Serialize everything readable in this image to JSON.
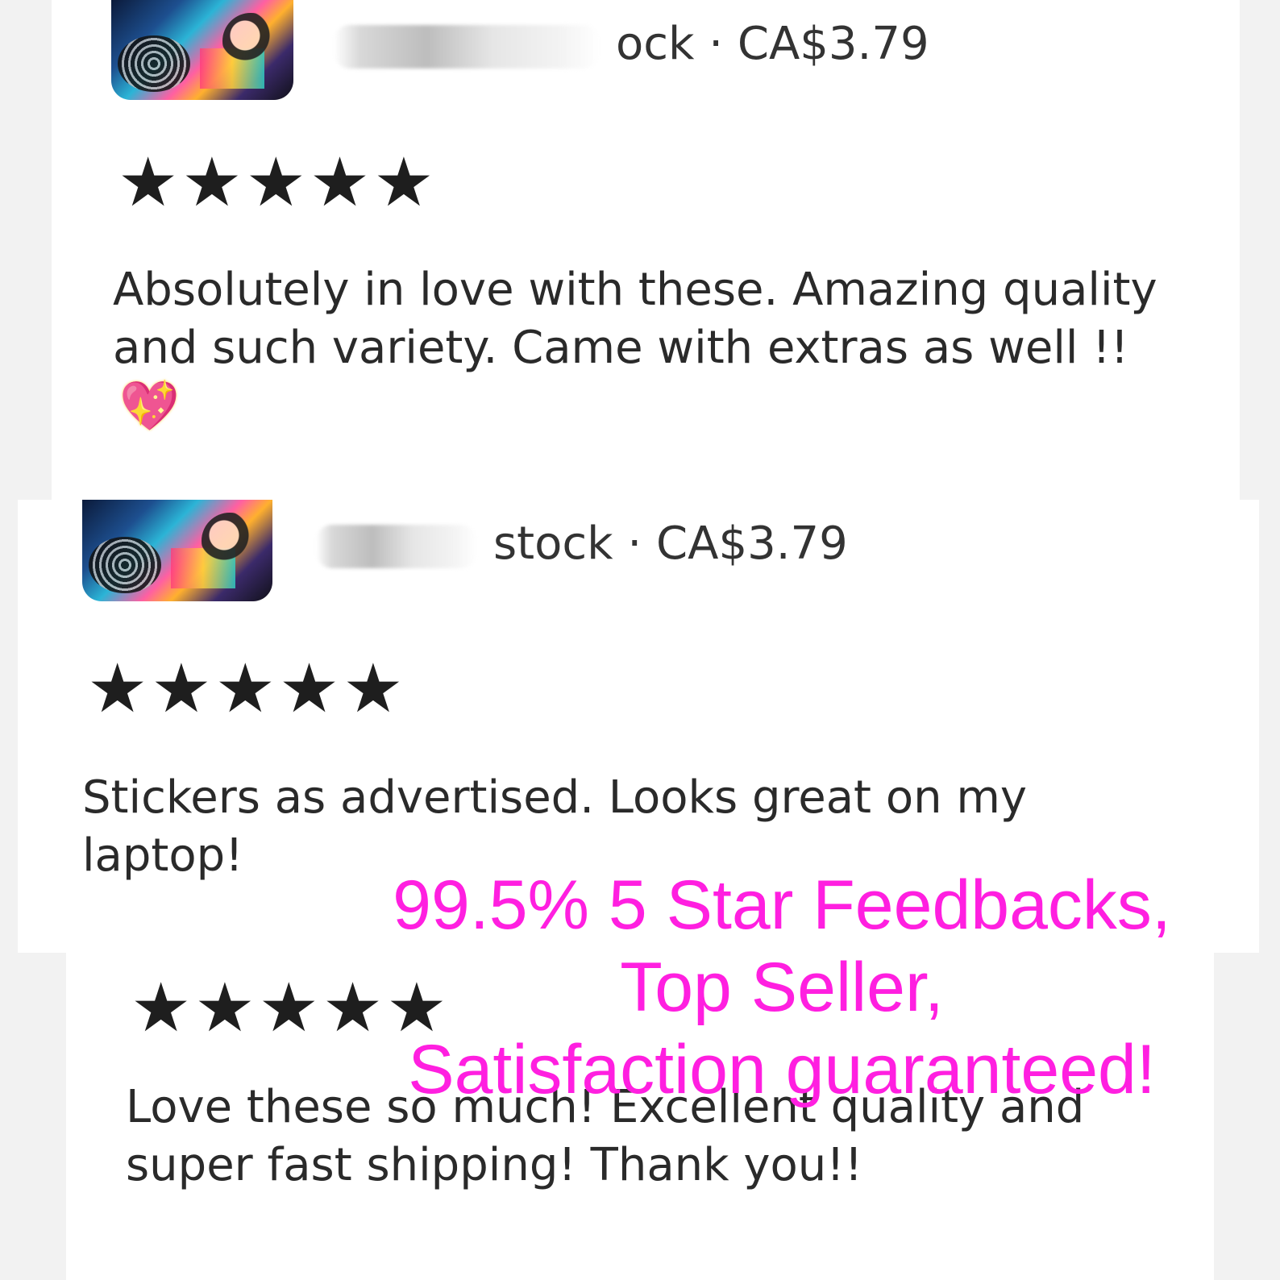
{
  "reviews": [
    {
      "rating": 5,
      "stars": "★★★★★",
      "stock_text": "ock",
      "price": "CA$3.79",
      "text": "Absolutely in love with these. Amazing quality and such variety. Came with extras as well !!",
      "emoji": "💖"
    },
    {
      "rating": 5,
      "stars": "★★★★★",
      "stock_text": "stock",
      "price": "CA$3.79",
      "text": "Stickers as advertised. Looks great on my laptop!"
    },
    {
      "rating": 5,
      "stars": "★★★★★",
      "text": "Love these so much! Excellent quality and super fast shipping! Thank you!!"
    }
  ],
  "promo": {
    "line1": "99.5% 5 Star Feedbacks,",
    "line2": "Top Seller,",
    "line3": "Satisfaction guaranteed!"
  },
  "colors": {
    "promo_text": "#ff1fe0",
    "stars": "#1e1e1e",
    "review_text": "#2a2a2a"
  }
}
